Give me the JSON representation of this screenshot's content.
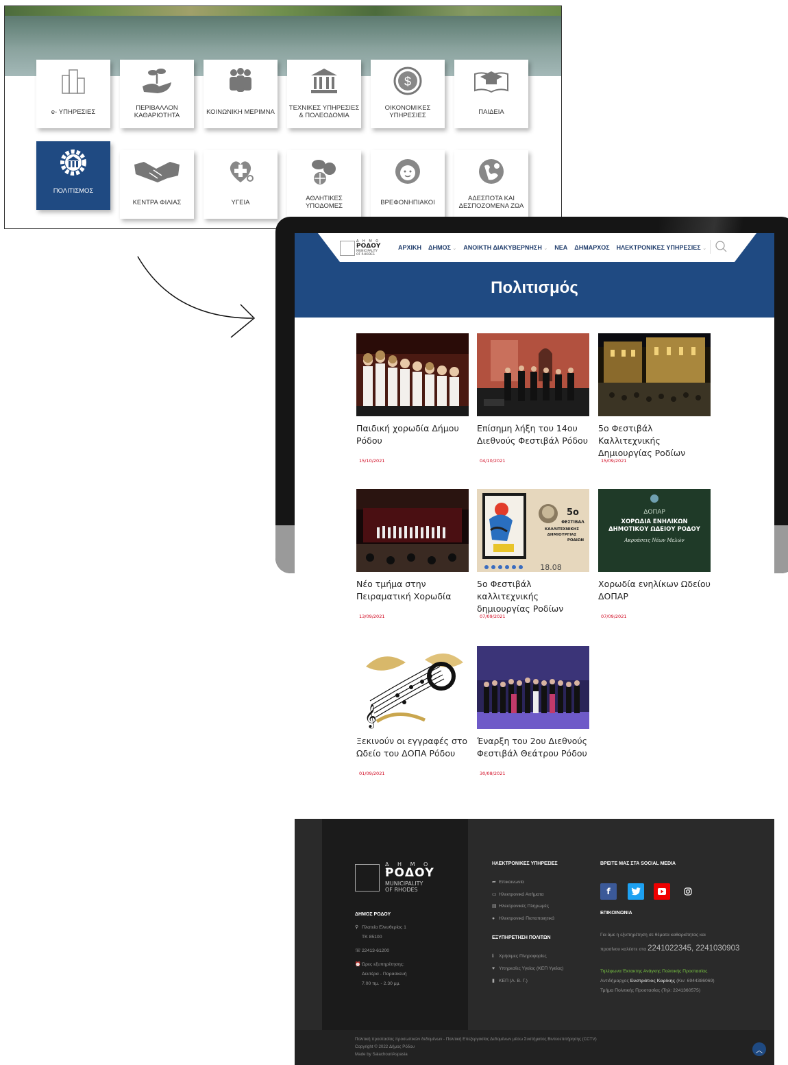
{
  "categories": [
    {
      "label": "e- ΥΠΗΡΕΣΙΕΣ",
      "icon": "buildings-icon"
    },
    {
      "label": "ΠΕΡΙΒΑΛΛΟΝ ΚΑΘΑΡΙΟΤΗΤΑ",
      "icon": "plant-hand-icon"
    },
    {
      "label": "ΚΟΙΝΩΝΙΚΗ ΜΕΡΙΜΝΑ",
      "icon": "people-group-icon"
    },
    {
      "label": "ΤΕΧΝΙΚΕΣ ΥΠΗΡΕΣΙΕΣ & ΠΟΛΕΟΔΟΜΙΑ",
      "icon": "columns-building-icon"
    },
    {
      "label": "ΟΙΚΟΝΟΜΙΚΕΣ ΥΠΗΡΕΣΙΕΣ",
      "icon": "globe-dollar-icon"
    },
    {
      "label": "ΠΑΙΔΕΙΑ",
      "icon": "graduation-book-icon"
    },
    {
      "label": "ΠΟΛΙΤΙΣΜΟΣ",
      "icon": "gear-building-icon",
      "active": true
    },
    {
      "label": "ΚΕΝΤΡΑ ΦΙΛΙΑΣ",
      "icon": "handshake-icon"
    },
    {
      "label": "ΥΓΕΙΑ",
      "icon": "health-heart-icon"
    },
    {
      "label": "ΑΘΛΗΤΙΚΕΣ ΥΠΟΔΟΜΕΣ",
      "icon": "sports-balls-icon"
    },
    {
      "label": "ΒΡΕΦΟΝΗΠΙΑΚΟΙ",
      "icon": "baby-face-icon"
    },
    {
      "label": "ΑΔΕΣΠΟΤΑ ΚΑΙ ΔΕΣΠΟΖΟΜΕΝΑ ΖΩΑ",
      "icon": "globe-animal-icon"
    }
  ],
  "header": {
    "logo": {
      "top": "Δ Η Μ Ο Σ",
      "name": "ΡΟΔΟΥ",
      "sub1": "MUNICIPALITY",
      "sub2": "OF RHODES"
    },
    "nav": [
      {
        "label": "ΑΡΧΙΚΗ",
        "dropdown": false
      },
      {
        "label": "ΔΗΜΟΣ",
        "dropdown": true
      },
      {
        "label": "ΑΝΟΙΚΤΗ ΔΙΑΚΥΒΕΡΝΗΣΗ",
        "dropdown": true
      },
      {
        "label": "ΝΕΑ",
        "dropdown": false
      },
      {
        "label": "ΔΗΜΑΡΧΟΣ",
        "dropdown": false
      },
      {
        "label": "ΗΛΕΚΤΡΟΝΙΚΕΣ ΥΠΗΡΕΣΙΕΣ",
        "dropdown": true
      }
    ],
    "page_title": "Πολιτισμός",
    "accent_color": "#1f4a82"
  },
  "articles": [
    {
      "title": "Παιδική χορωδία Δήμου Ρόδου",
      "date": "15/10/2021"
    },
    {
      "title": "Επίσημη λήξη του 14ου Διεθνούς Φεστιβάλ Ρόδου",
      "date": "04/10/2021"
    },
    {
      "title": "5ο Φεστιβάλ Καλλιτεχνικής Δημιουργίας Ροδίων",
      "date": "15/09/2021"
    },
    {
      "title": "Νέο τμήμα στην Πειραματική Χορωδία",
      "date": "13/09/2021"
    },
    {
      "title": "5ο Φεστιβάλ καλλιτεχνικής δημιουργίας Ροδίων",
      "date": "07/09/2021"
    },
    {
      "title": "Χορωδία ενηλίκων Ωδείου ΔΟΠΑΡ",
      "date": "07/09/2021"
    },
    {
      "title": "Ξεκινούν οι εγγραφές στο Ωδείο του ΔΟΠΑ Ρόδου",
      "date": "01/09/2021"
    },
    {
      "title": "Έναρξη του 2ου Διεθνούς Φεστιβάλ Θεάτρου Ρόδου",
      "date": "30/08/2021"
    }
  ],
  "posters": {
    "festival": {
      "num": "5ο",
      "l1": "ΦΕΣΤΙΒΑΛ",
      "l2": "ΚΑΛΛΙΤΕΧΝΙΚΗΣ",
      "l3": "ΔΗΜΙΟΥΡΓΙΑΣ",
      "l4": "ΡΟΔΙΩΝ",
      "date": "18.08"
    },
    "choir": {
      "brand": "ΔΟΠΑΡ",
      "l1": "ΧΟΡΩΔΙΑ ΕΝΗΛΙΚΩΝ",
      "l2": "ΔΗΜΟΤΙΚΟΥ ΩΔΕΙΟΥ ΡΟΔΟΥ",
      "l3": "Ακροάσεις Νέων Μελών"
    }
  },
  "footer": {
    "logo": {
      "top": "Δ Η Μ Ο Σ",
      "name": "ΡΟΔΟΥ",
      "sub1": "MUNICIPALITY",
      "sub2": "OF RHODES"
    },
    "org_title": "ΔΗΜΟΣ ΡΟΔΟΥ",
    "address1": "Πλατεία Ελευθερίας 1",
    "address2": "ΤΚ 85100",
    "phone": "22413-61200",
    "hours_label": "Ώρες εξυπηρέτησης:",
    "hours_days": "Δευτέρα - Παρασκευή",
    "hours_time": "7.00 πμ. - 2.30 μμ.",
    "eservices_title": "ΗΛΕΚΤΡΟΝΙΚΕΣ ΥΠΗΡΕΣΙΕΣ",
    "eservices": [
      "Επικοινωνία",
      "Ηλεκτρονικά Αιτήματα",
      "Ηλεκτρονικές Πληρωμές",
      "Ηλεκτρονικά Πιστοποιητικά"
    ],
    "service_title": "ΕΞΥΠΗΡΕΤΗΣΗ ΠΟΛΙΤΩΝ",
    "service_items": [
      "Χρήσιμες Πληροφορίες",
      "Υπηρεσίες Υγείας (ΚΕΠ Υγείας)",
      "ΚΕΠ (Α. Β. Γ.)"
    ],
    "social_title": "ΒΡΕΙΤΕ ΜΑΣ ΣΤΑ SOCIAL MEDIA",
    "contact_title": "ΕΠΙΚΟΙΝΩΝΙΑ",
    "contact_line1": "Για άμε  η εξυπηρέτηση σε θέματα καθαριότητας και",
    "contact_line2": "πρασίνου καλέστε στα",
    "contact_phones": "2241022345, 2241030903",
    "emergency_title": "Τηλέφωνα Έκτακτης Ανάγκης Πολιτικής Προστασίας",
    "emergency_line1_pre": "Αντιδήμαρχος",
    "emergency_name": "Ευστράτιος Καρίκης",
    "emergency_line1_post": "(Κιν: 6944386069)",
    "emergency_line2": "Τμήμα Πολιτικής Προστασίας (Τηλ: 2241360575)",
    "bottom1": "Πολιτική προστασίας προσωπικών δεδομένων - Πολιτική Επεξεργασίας Δεδομένων μέσω Συστήματος Βιντεοεπιτήρησης (CCTV)",
    "bottom2": "Copyright © 2022 Δήμος Ρόδου",
    "bottom3": "Made by SalachouriAspasia"
  }
}
